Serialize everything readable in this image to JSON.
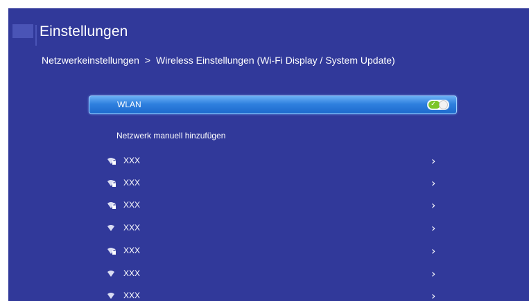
{
  "header": {
    "title": "Einstellungen",
    "breadcrumb": {
      "parent": "Netzwerkeinstellungen",
      "separator": ">",
      "current": "Wireless Einstellungen (Wi-Fi Display / System Update)"
    }
  },
  "wlan": {
    "label": "WLAN",
    "enabled": true,
    "toggle_on_color": "#7dc52a"
  },
  "manual_add": {
    "label": "Netzwerk manuell hinzufügen"
  },
  "networks": [
    {
      "name": "XXX",
      "icon": "wifi-locked-icon",
      "chevron": "›"
    },
    {
      "name": "XXX",
      "icon": "wifi-locked-icon",
      "chevron": "›"
    },
    {
      "name": "XXX",
      "icon": "wifi-locked-icon",
      "chevron": "›"
    },
    {
      "name": "XXX",
      "icon": "wifi-icon",
      "chevron": "›"
    },
    {
      "name": "XXX",
      "icon": "wifi-locked-icon",
      "chevron": "›"
    },
    {
      "name": "XXX",
      "icon": "wifi-icon",
      "chevron": "›"
    },
    {
      "name": "XXX",
      "icon": "wifi-icon",
      "chevron": "›"
    }
  ],
  "colors": {
    "background": "#31399a",
    "highlight": "#2f80df",
    "text": "#ffffff"
  }
}
